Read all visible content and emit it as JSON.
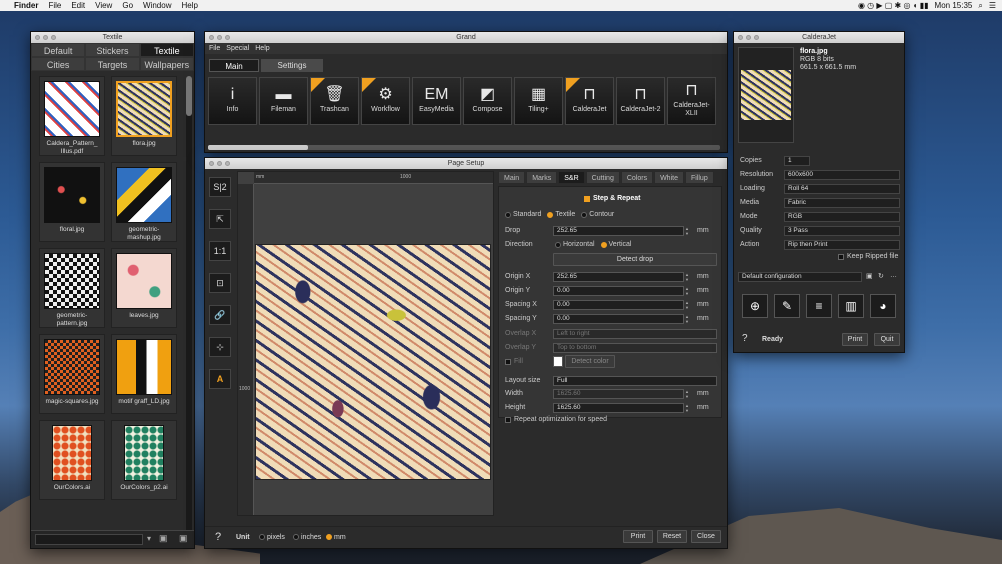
{
  "menubar": {
    "apple": "",
    "app": "Finder",
    "items": [
      "File",
      "Edit",
      "View",
      "Go",
      "Window",
      "Help"
    ],
    "clock": "Mon 15:35"
  },
  "textile": {
    "title": "Textile",
    "tabs": [
      "Default",
      "Stickers",
      "Textile",
      "Cities",
      "Targets",
      "Wallpapers"
    ],
    "thumbs": [
      {
        "label": "Caldera_Pattern_\nIllus.pdf"
      },
      {
        "label": "flora.jpg"
      },
      {
        "label": "floral.jpg"
      },
      {
        "label": "geometric-\nmashup.jpg"
      },
      {
        "label": "geometric-\npattern.jpg"
      },
      {
        "label": "leaves.jpg"
      },
      {
        "label": "magic-squares.jpg"
      },
      {
        "label": "motif graff_LD.jpg"
      },
      {
        "label": "OurColors.ai"
      },
      {
        "label": "OurColors_p2.ai"
      }
    ]
  },
  "grand": {
    "title": "Grand",
    "menu": [
      "File",
      "Special",
      "Help"
    ],
    "tabs": [
      "Main",
      "Settings"
    ],
    "tools": [
      {
        "label": "Info",
        "icon": "i"
      },
      {
        "label": "Fileman",
        "icon": "▬"
      },
      {
        "label": "Trashcan",
        "icon": "🗑"
      },
      {
        "label": "Workflow",
        "icon": "⚙"
      },
      {
        "label": "EasyMedia",
        "icon": "EM"
      },
      {
        "label": "Compose",
        "icon": "◩"
      },
      {
        "label": "Tiling+",
        "icon": "▦"
      },
      {
        "label": "CalderaJet",
        "icon": "⊓"
      },
      {
        "label": "CalderaJet-2",
        "icon": "⊓"
      },
      {
        "label": "CalderaJet-\nXLII",
        "icon": "⊓"
      }
    ]
  },
  "pagesetup": {
    "title": "Page Setup",
    "left_tools": [
      "S|2",
      "⇱",
      "1:1",
      "⊡",
      "🔗",
      "⊹",
      "A"
    ],
    "ruler": {
      "unit": "mm",
      "h_mark": "1000",
      "v_mark": "1000"
    },
    "tabs": [
      "Main",
      "Marks",
      "S&R",
      "Cutting",
      "Colors",
      "White",
      "Fillup"
    ],
    "section": "Step & Repeat",
    "mode_options": [
      "Standard",
      "Textile",
      "Contour"
    ],
    "drop_label": "Drop",
    "drop_value": "252.65",
    "drop_unit": "mm",
    "direction_label": "Direction",
    "direction_options": [
      "Horizontal",
      "Vertical"
    ],
    "detect_drop": "Detect drop",
    "origin_x_label": "Origin X",
    "origin_x": "252.65",
    "origin_y_label": "Origin Y",
    "origin_y": "0.00",
    "spacing_x_label": "Spacing X",
    "spacing_x": "0.00",
    "spacing_y_label": "Spacing Y",
    "spacing_y": "0.00",
    "overlap_x_label": "Overlap X",
    "overlap_x": "Left to right",
    "overlap_y_label": "Overlap Y",
    "overlap_y": "Top to bottom",
    "fill_label": "Fill",
    "detect_color": "Detect color",
    "layout_size_label": "Layout size",
    "layout_size": "Full",
    "width_label": "Width",
    "width": "1625.60",
    "height_label": "Height",
    "height": "1625.60",
    "repeat_opt": "Repeat optimization for speed",
    "unit_label": "Unit",
    "unit_options": [
      "pixels",
      "inches",
      "mm"
    ],
    "buttons": {
      "print": "Print",
      "reset": "Reset",
      "close": "Close"
    },
    "help": "?",
    "unit_mm": "mm"
  },
  "calderajet": {
    "title": "CalderaJet",
    "file": "flora.jpg",
    "info1": "RGB 8 bits",
    "info2": "661.5 x 661.5 mm",
    "fields": [
      {
        "label": "Copies",
        "value": "1"
      },
      {
        "label": "Resolution",
        "value": "600x600"
      },
      {
        "label": "Loading",
        "value": "Roll 64"
      },
      {
        "label": "Media",
        "value": "Fabric"
      },
      {
        "label": "Mode",
        "value": "RGB"
      },
      {
        "label": "Quality",
        "value": "3 Pass"
      },
      {
        "label": "Action",
        "value": "Rip then Print"
      }
    ],
    "keep_ripped": "Keep Ripped file",
    "config": "Default configuration",
    "status": "Ready",
    "print": "Print",
    "quit": "Quit",
    "help": "?"
  }
}
